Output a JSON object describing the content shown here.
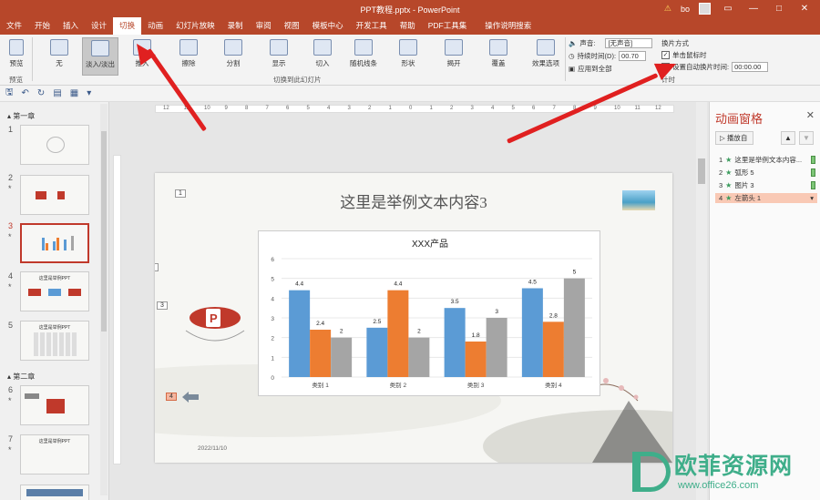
{
  "window": {
    "title": "PPT教程.pptx - PowerPoint",
    "user": "bo",
    "warning_icon": "warning-icon",
    "minimize": "—",
    "restore": "□",
    "close": "✕"
  },
  "menu": {
    "items": [
      "文件",
      "开始",
      "插入",
      "设计",
      "切换",
      "动画",
      "幻灯片放映",
      "录制",
      "审阅",
      "视图",
      "模板中心",
      "开发工具",
      "帮助",
      "PDF工具集",
      "操作说明搜索"
    ],
    "active_index": 4
  },
  "ribbon": {
    "preview": {
      "label": "预览",
      "group": "预览"
    },
    "transitions": [
      "无",
      "淡入/淡出",
      "推入",
      "擦除",
      "分割",
      "显示",
      "切入",
      "随机线条",
      "形状",
      "揭开",
      "覆盖"
    ],
    "selected_index": 1,
    "effect_options": "效果选项",
    "group_label": "切换到此幻灯片",
    "sound_label": "声音:",
    "sound_value": "[无声音]",
    "duration_label": "持续时间(D):",
    "duration_value": "00.70",
    "apply_all": "应用到全部",
    "advance_label": "换片方式",
    "on_click": "单击鼠标时",
    "on_click_checked": "✓",
    "auto_after": "设置自动换片时间:",
    "auto_value": "00:00.00",
    "timing_group": "计时"
  },
  "thumbs": {
    "section1": "第一章",
    "section2": "第二章",
    "numbers": [
      "1",
      "2",
      "3",
      "4",
      "5",
      "6",
      "7"
    ],
    "star": "*",
    "thumb_text_4": "这里是举例PPT",
    "thumb_text_5": "这里是举例PPT",
    "thumb_text_7": "这里是举例PPT"
  },
  "ruler": {
    "labels": [
      "12",
      "11",
      "10",
      "9",
      "8",
      "7",
      "6",
      "5",
      "4",
      "3",
      "2",
      "1",
      "0",
      "1",
      "2",
      "3",
      "4",
      "5",
      "6",
      "7",
      "8",
      "9",
      "10",
      "11",
      "12"
    ]
  },
  "slide": {
    "title": "这里是举例文本内容3",
    "tags": [
      "1",
      "2",
      "3",
      "4"
    ],
    "date": "2022/11/10"
  },
  "chart_data": {
    "type": "bar",
    "title": "XXX产品",
    "categories": [
      "类别 1",
      "类别 2",
      "类别 3",
      "类别 4"
    ],
    "series": [
      {
        "values": [
          4.4,
          2.5,
          3.5,
          4.5
        ],
        "color": "#5b9bd5"
      },
      {
        "values": [
          2.4,
          4.4,
          1.8,
          2.8
        ],
        "color": "#ed7d31"
      },
      {
        "values": [
          2,
          2,
          3,
          5
        ],
        "color": "#a5a5a5"
      }
    ],
    "ylim": [
      0,
      6
    ],
    "yticks": [
      "0",
      "1",
      "2",
      "3",
      "4",
      "5",
      "6"
    ],
    "grid": true
  },
  "anim": {
    "title": "动画窗格",
    "close": "✕",
    "play": "播放自",
    "up": "▲",
    "down": "▼",
    "items": [
      {
        "num": "1",
        "label": "这里是举例文本内容..."
      },
      {
        "num": "2",
        "label": "弧形 5"
      },
      {
        "num": "3",
        "label": "图片 3"
      },
      {
        "num": "4",
        "label": "左箭头 1"
      }
    ]
  },
  "watermark": {
    "name": "欧菲资源网",
    "url": "www.office26.com"
  }
}
